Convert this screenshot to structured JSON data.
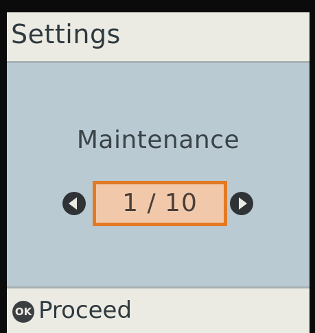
{
  "header": {
    "title": "Settings"
  },
  "main": {
    "menu_title": "Maintenance",
    "pager": {
      "label": "1 / 10",
      "current": 1,
      "total": 10
    },
    "prev_icon": "left-arrow-circle-icon",
    "next_icon": "right-arrow-circle-icon"
  },
  "footer": {
    "ok_icon_label": "OK",
    "action_label": "Proceed"
  },
  "colors": {
    "screen_bg": "#b9cad3",
    "bar_bg": "#ecebe3",
    "selection_border": "#e37a23",
    "selection_fill": "#f1c9aa"
  }
}
